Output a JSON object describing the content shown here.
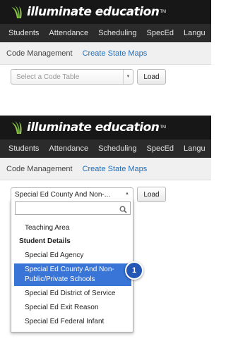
{
  "brand": {
    "name": "illuminate education",
    "tm": "TM"
  },
  "nav": {
    "items": [
      "Students",
      "Attendance",
      "Scheduling",
      "SpecEd",
      "Langu"
    ]
  },
  "subnav": {
    "title": "Code Management",
    "link": "Create State Maps"
  },
  "step1": {
    "select_placeholder": "Select a Code Table",
    "load_label": "Load"
  },
  "step2": {
    "select_value": "Special Ed County And Non-...",
    "load_label": "Load",
    "dropdown": {
      "search_value": "",
      "options": [
        {
          "label": "Teaching Area",
          "type": "option"
        },
        {
          "label": "Student Details",
          "type": "group"
        },
        {
          "label": "Special Ed Agency",
          "type": "option"
        },
        {
          "label": "Special Ed County And Non-Public/Private Schools",
          "type": "option",
          "highlighted": true
        },
        {
          "label": "Special Ed District of Service",
          "type": "option"
        },
        {
          "label": "Special Ed Exit Reason",
          "type": "option"
        },
        {
          "label": "Special Ed Federal Infant",
          "type": "option"
        }
      ]
    }
  },
  "callout": {
    "number": "1"
  },
  "colors": {
    "brand_bar": "#171717",
    "nav_bar": "#2b2b2b",
    "link": "#1f6fbd",
    "highlight": "#3875d7",
    "badge": "#2456b3",
    "logo_swirl": "#8dc63f"
  },
  "icons": [
    "logo-swirl-icon",
    "dropdown-arrow-icon",
    "search-icon"
  ]
}
